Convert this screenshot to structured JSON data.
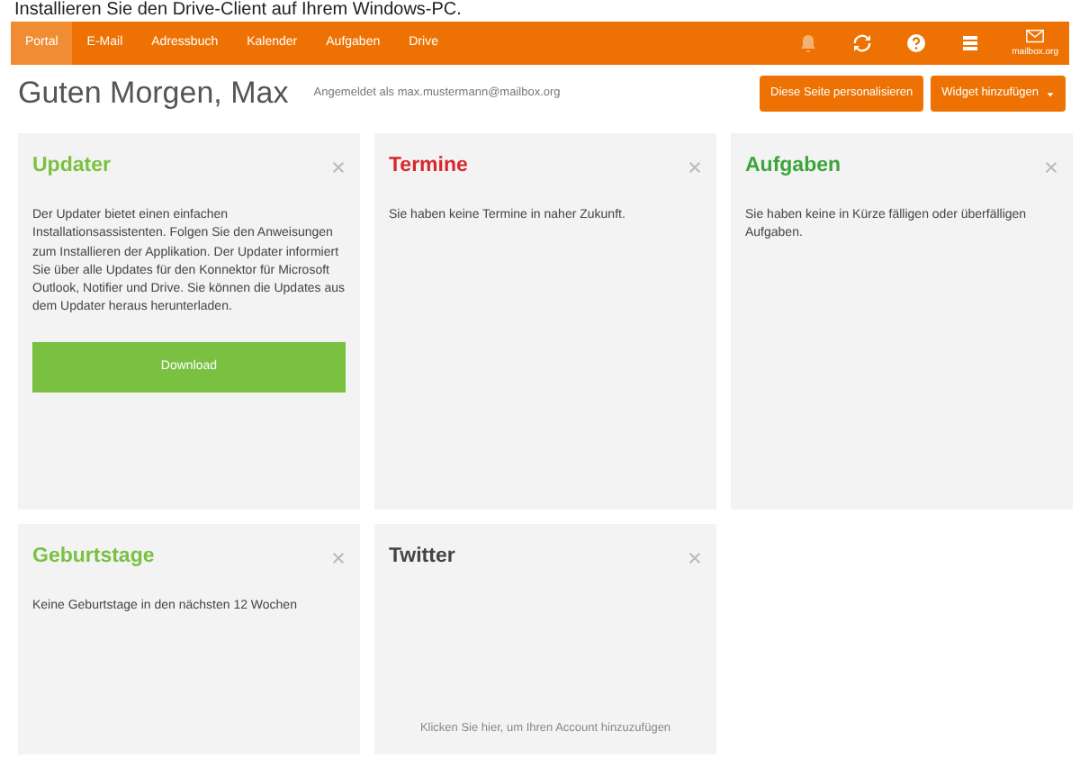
{
  "caption": "Installieren Sie den Drive-Client auf Ihrem Windows-PC.",
  "nav": {
    "items": [
      {
        "label": "Portal",
        "selected": true
      },
      {
        "label": "E-Mail",
        "selected": false
      },
      {
        "label": "Adressbuch",
        "selected": false
      },
      {
        "label": "Kalender",
        "selected": false
      },
      {
        "label": "Aufgaben",
        "selected": false
      },
      {
        "label": "Drive",
        "selected": false
      }
    ],
    "icons": [
      {
        "kind": "bell",
        "disabled": true
      },
      {
        "kind": "sync",
        "disabled": false
      },
      {
        "kind": "help",
        "disabled": false
      },
      {
        "kind": "menu",
        "disabled": false
      }
    ],
    "logo_text": "mailbox.org"
  },
  "header": {
    "greeting": "Guten Morgen, Max",
    "signed_in": "Angemeldet als max.mustermann@mailbox.org",
    "buttons": [
      {
        "label": "Diese Seite personalisieren",
        "caret": false
      },
      {
        "label": "Widget hinzufügen",
        "caret": true
      }
    ]
  },
  "widgets": [
    {
      "title": "Updater",
      "color": "#7ac142",
      "kind": "button",
      "text": "Der Updater bietet einen einfachen Installationsassistenten. Folgen Sie den Anweisungen zum Installieren der Applikation. Der Updater informiert Sie über alle Updates für den Konnektor für Microsoft Outlook, Notifier und Drive. Sie können die Updates aus dem Updater heraus herunterladen.",
      "action": "Download"
    },
    {
      "title": "Termine",
      "color": "#d9272e",
      "kind": "text",
      "text": "Sie haben keine Termine in naher Zukunft."
    },
    {
      "title": "Aufgaben",
      "color": "#3aa53a",
      "kind": "text",
      "text": "Sie haben keine in Kürze fälligen oder überfälligen Aufgaben."
    },
    {
      "title": "Geburtstage",
      "color": "#7ac142",
      "kind": "text",
      "text": "Keine Geburtstage in den nächsten 12 Wochen"
    },
    {
      "title": "Twitter",
      "color": "#444444",
      "kind": "link",
      "action": "Klicken Sie hier, um Ihren Account hinzuzufügen"
    }
  ]
}
